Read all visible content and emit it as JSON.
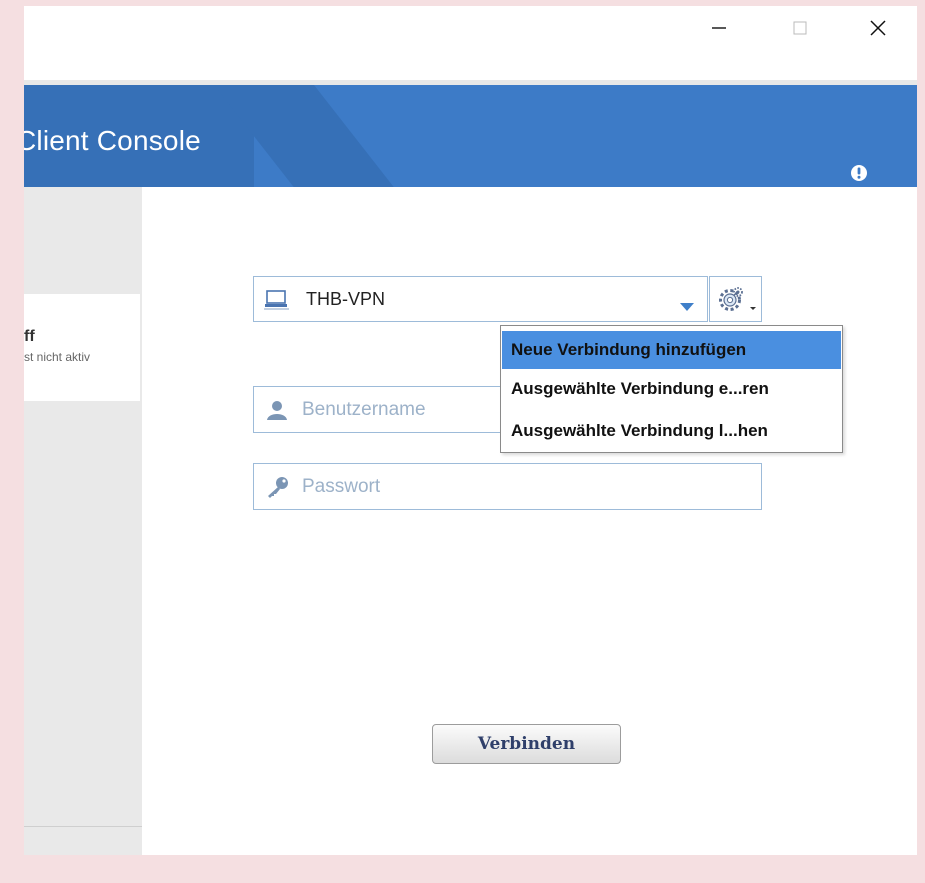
{
  "window": {
    "controls": {
      "minimize_icon": "minimize-icon",
      "maximize_icon": "maximize-icon",
      "close_icon": "close-icon"
    }
  },
  "header": {
    "title": "Client Console",
    "alert_icon": "alert-icon",
    "background": "#3d7bc7"
  },
  "sidebar": {
    "card": {
      "title": "ff",
      "subtitle": "st nicht aktiv"
    }
  },
  "connection": {
    "selected": "THB-VPN",
    "icon": "computer-icon",
    "settings_icon": "gear-icon"
  },
  "menu": {
    "items": [
      {
        "label": "Neue Verbindung hinzufügen",
        "active": true
      },
      {
        "label": "Ausgewählte Verbindung e...ren",
        "active": false
      },
      {
        "label": "Ausgewählte Verbindung l...hen",
        "active": false
      }
    ],
    "highlight": "#4a8fe0"
  },
  "form": {
    "username_placeholder": "Benutzername",
    "password_placeholder": "Passwort",
    "username_value": "",
    "password_value": "",
    "connect_label": "Verbinden"
  }
}
